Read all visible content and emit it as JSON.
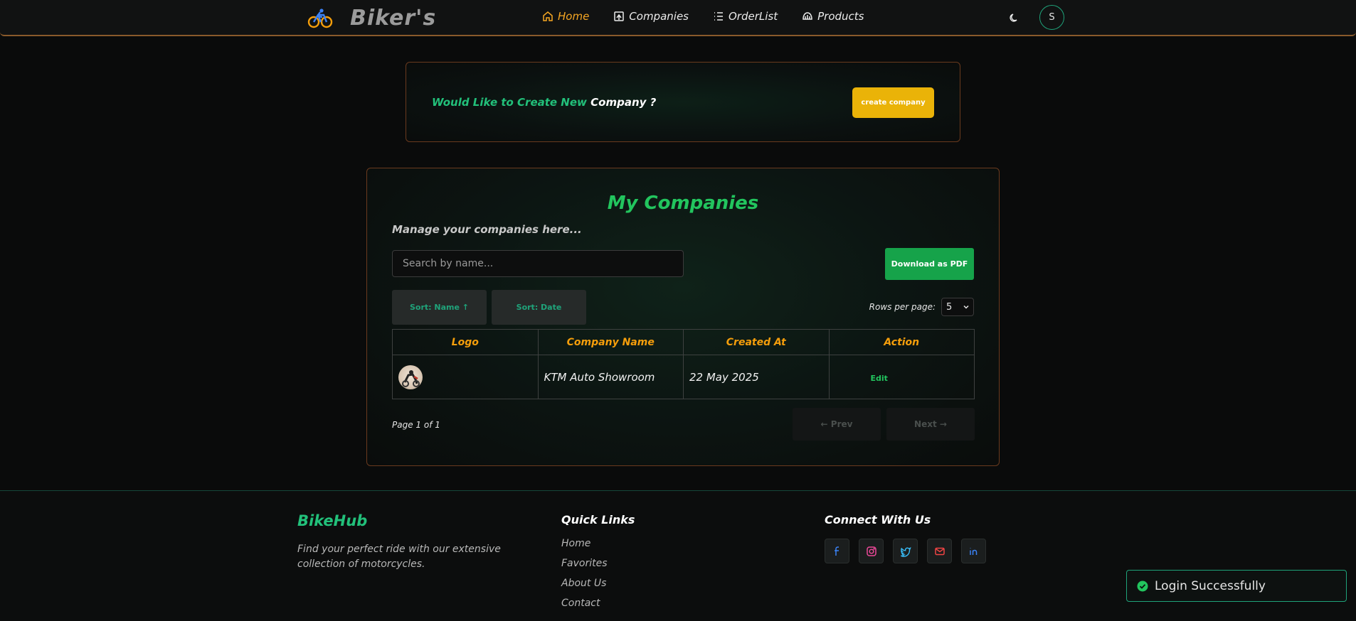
{
  "navbar": {
    "brand": "Biker's",
    "links": [
      {
        "label": "Home",
        "icon": "home-icon",
        "active": true
      },
      {
        "label": "Companies",
        "icon": "companies-icon",
        "active": false
      },
      {
        "label": "OrderList",
        "icon": "list-icon",
        "active": false
      },
      {
        "label": "Products",
        "icon": "helmet-icon",
        "active": false
      }
    ],
    "avatar_initial": "S"
  },
  "create_banner": {
    "text_part1": "Would Like to Create New",
    "text_part2": "Company ?",
    "button": "create company"
  },
  "companies": {
    "title": "My Companies",
    "subtitle": "Manage your companies here...",
    "search_placeholder": "Search by name...",
    "download_button": "Download as PDF",
    "sort_name": "Sort: Name ↑",
    "sort_date": "Sort: Date",
    "rows_label": "Rows per page:",
    "rows_value": "5",
    "columns": [
      "Logo",
      "Company Name",
      "Created At",
      "Action"
    ],
    "rows": [
      {
        "name": "KTM Auto Showroom",
        "created": "22 May 2025",
        "action": "Edit"
      }
    ],
    "page_info": "Page 1 of 1",
    "prev": "← Prev",
    "next": "Next →"
  },
  "footer": {
    "brand": "BikeHub",
    "description": "Find your perfect ride with our extensive collection of motorcycles.",
    "quick_links_title": "Quick Links",
    "quick_links": [
      "Home",
      "Favorites",
      "About Us",
      "Contact"
    ],
    "connect_title": "Connect With Us",
    "socials": [
      "facebook-icon",
      "instagram-icon",
      "twitter-icon",
      "mail-icon",
      "linkedin-icon"
    ]
  },
  "toast": {
    "message": "Login Successfully"
  },
  "colors": {
    "accent_orange": "#f5a623",
    "green": "#22c55e",
    "yellow_button": "#eab308",
    "pdf_button": "#16a34a"
  }
}
